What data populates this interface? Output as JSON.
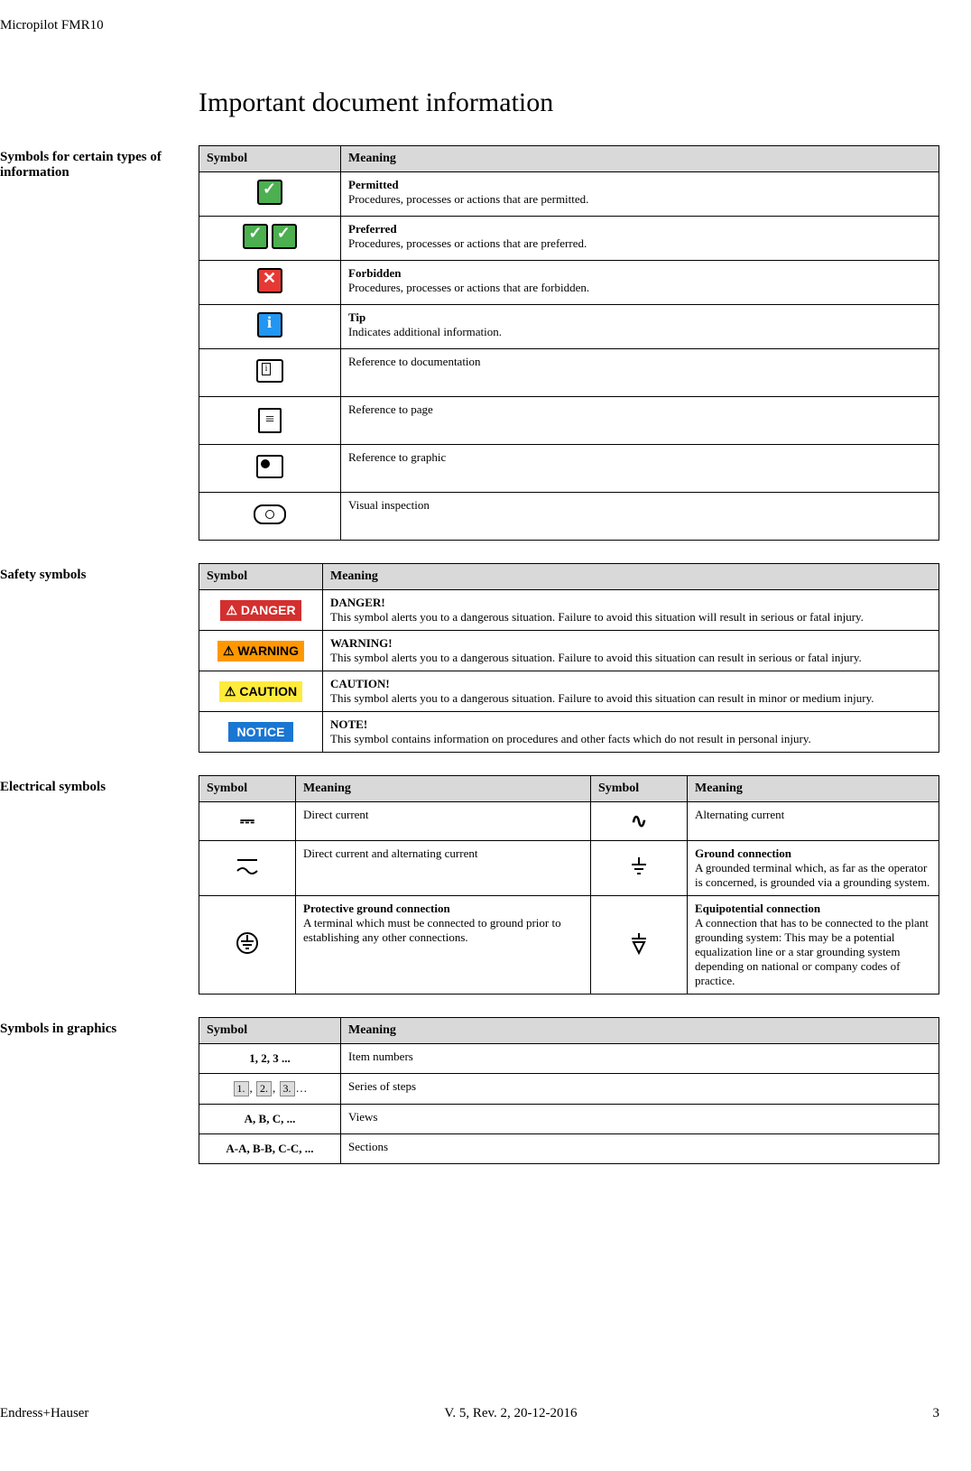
{
  "header": {
    "product": "Micropilot FMR10"
  },
  "title": "Important document information",
  "sections": {
    "info_symbols": {
      "label": "Symbols for certain types of information",
      "th_symbol": "Symbol",
      "th_meaning": "Meaning",
      "rows": [
        {
          "title": "Permitted",
          "desc": "Procedures, processes or actions that are permitted."
        },
        {
          "title": "Preferred",
          "desc": "Procedures, processes or actions that are preferred."
        },
        {
          "title": "Forbidden",
          "desc": "Procedures, processes or actions that are forbidden."
        },
        {
          "title": "Tip",
          "desc": "Indicates additional information."
        },
        {
          "desc": "Reference to documentation"
        },
        {
          "desc": "Reference to page"
        },
        {
          "desc": "Reference to graphic"
        },
        {
          "desc": "Visual inspection"
        }
      ]
    },
    "safety": {
      "label": "Safety symbols",
      "th_symbol": "Symbol",
      "th_meaning": "Meaning",
      "rows": [
        {
          "badge": "DANGER",
          "title": "DANGER!",
          "desc": "This symbol alerts you to a dangerous situation. Failure to avoid this situation will result in serious or fatal injury."
        },
        {
          "badge": "WARNING",
          "title": "WARNING!",
          "desc": "This symbol alerts you to a dangerous situation. Failure to avoid this situation can result in serious or fatal injury."
        },
        {
          "badge": "CAUTION",
          "title": "CAUTION!",
          "desc": "This symbol alerts you to a dangerous situation. Failure to avoid this situation can result in minor or medium injury."
        },
        {
          "badge": "NOTICE",
          "title": "NOTE!",
          "desc": "This symbol contains information on procedures and other facts which do not result in personal injury."
        }
      ]
    },
    "electrical": {
      "label": "Electrical symbols",
      "th_symbol": "Symbol",
      "th_meaning": "Meaning",
      "cells": {
        "dc": "Direct current",
        "ac": "Alternating current",
        "dcac": "Direct current and alternating current",
        "ground_t": "Ground connection",
        "ground_d": "A grounded terminal which, as far as the operator is concerned, is grounded via a grounding system.",
        "pground_t": "Protective ground connection",
        "pground_d": "A terminal which must be connected to ground prior to establishing any other connections.",
        "equi_t": "Equipotential connection",
        "equi_d": "A connection that has to be connected to the plant grounding system: This may be a potential equalization line or a star grounding system depending on national or company codes of practice."
      }
    },
    "graphics": {
      "label": "Symbols in graphics",
      "th_symbol": "Symbol",
      "th_meaning": "Meaning",
      "rows": [
        {
          "sym": "1, 2, 3 ...",
          "desc": "Item numbers"
        },
        {
          "desc": "Series of steps"
        },
        {
          "sym": "A, B, C, ...",
          "desc": "Views"
        },
        {
          "sym": "A-A, B-B, C-C, ...",
          "desc": "Sections"
        }
      ]
    }
  },
  "footer": {
    "left": "Endress+Hauser",
    "center": "V. 5, Rev. 2, 20-12-2016",
    "right": "3"
  }
}
